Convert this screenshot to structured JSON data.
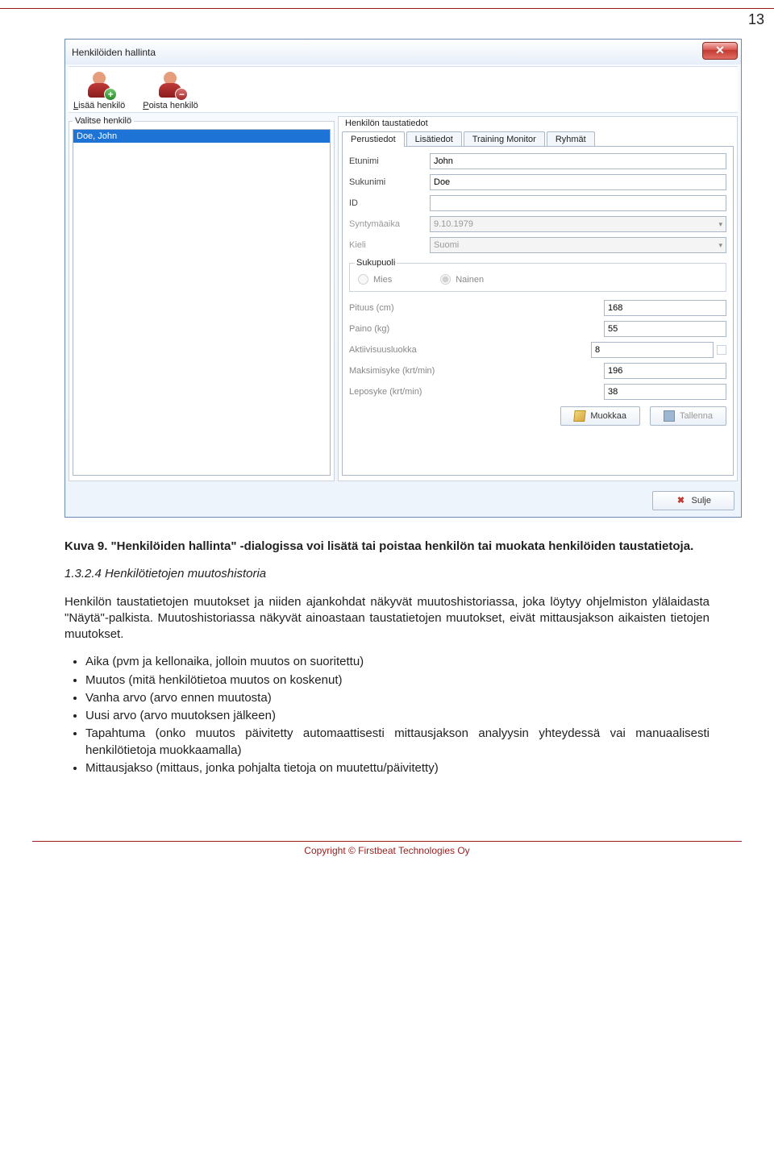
{
  "page_number": "13",
  "window": {
    "title": "Henkilöiden hallinta",
    "toolbar": {
      "add_label": "Lisää henkilö",
      "remove_label": "Poista henkilö"
    },
    "left": {
      "legend": "Valitse henkilö",
      "items": [
        "Doe, John"
      ]
    },
    "right": {
      "title": "Henkilön taustatiedot",
      "tabs": [
        "Perustiedot",
        "Lisätiedot",
        "Training Monitor",
        "Ryhmät"
      ],
      "form": {
        "etunimi_label": "Etunimi",
        "etunimi_value": "John",
        "sukunimi_label": "Sukunimi",
        "sukunimi_value": "Doe",
        "id_label": "ID",
        "id_value": "",
        "synt_label": "Syntymäaika",
        "synt_value": "9.10.1979",
        "kieli_label": "Kieli",
        "kieli_value": "Suomi",
        "sukupuoli_legend": "Sukupuoli",
        "mies_label": "Mies",
        "nainen_label": "Nainen",
        "pituus_label": "Pituus (cm)",
        "pituus_value": "168",
        "paino_label": "Paino (kg)",
        "paino_value": "55",
        "aktiivisuus_label": "Aktiivisuusluokka",
        "aktiivisuus_value": "8",
        "maks_label": "Maksimisyke (krt/min)",
        "maks_value": "196",
        "lepo_label": "Leposyke (krt/min)",
        "lepo_value": "38"
      },
      "buttons": {
        "edit": "Muokkaa",
        "save": "Tallenna",
        "close": "Sulje"
      }
    }
  },
  "doc": {
    "caption": "Kuva 9. \"Henkilöiden hallinta\" -dialogissa voi lisätä tai poistaa henkilön tai muokata henkilöiden taustatietoja.",
    "heading": "1.3.2.4 Henkilötietojen muutoshistoria",
    "p1": "Henkilön taustatietojen muutokset ja niiden ajankohdat näkyvät muutoshistoriassa, joka löytyy ohjelmiston ylälaidasta \"Näytä\"-palkista. Muutoshistoriassa näkyvät ainoastaan taustatietojen muutokset, eivät mittausjakson aikaisten tietojen muutokset.",
    "bullets": [
      "Aika (pvm ja kellonaika, jolloin muutos on suoritettu)",
      "Muutos (mitä henkilötietoa muutos on koskenut)",
      "Vanha arvo (arvo ennen muutosta)",
      "Uusi arvo (arvo muutoksen jälkeen)",
      "Tapahtuma (onko muutos päivitetty automaattisesti mittausjakson analyysin yhteydessä vai manuaalisesti henkilötietoja muokkaamalla)",
      "Mittausjakso (mittaus, jonka pohjalta tietoja on muutettu/päivitetty)"
    ]
  },
  "footer": "Copyright © Firstbeat Technologies Oy"
}
